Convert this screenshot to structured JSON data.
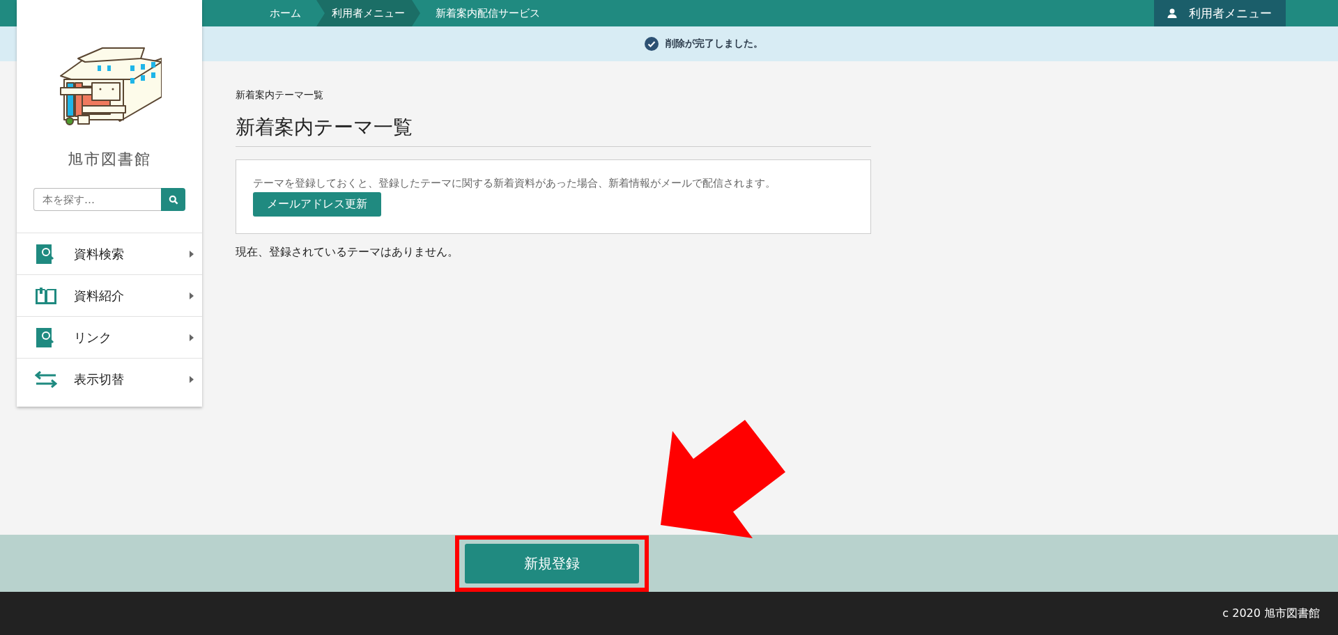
{
  "breadcrumb": [
    {
      "label": "ホーム",
      "selected": false
    },
    {
      "label": "利用者メニュー",
      "selected": true
    },
    {
      "label": "新着案内配信サービス",
      "selected": false
    }
  ],
  "user_menu": {
    "label": "利用者メニュー"
  },
  "notice": {
    "text": "削除が完了しました。"
  },
  "sidebar": {
    "library_name": "旭市図書館",
    "search": {
      "placeholder": "本を探す…"
    },
    "items": [
      {
        "label": "資料検索",
        "kind": "search"
      },
      {
        "label": "資料紹介",
        "kind": "book"
      },
      {
        "label": "リンク",
        "kind": "search"
      },
      {
        "label": "表示切替",
        "kind": "switch"
      }
    ]
  },
  "page": {
    "breadcrumb_title": "新着案内テーマ一覧",
    "title": "新着案内テーマ一覧",
    "info_text": "テーマを登録しておくと、登録したテーマに関する新着資料があった場合、新着情報がメールで配信されます。",
    "email_button": "メールアドレス更新",
    "empty_text": "現在、登録されているテーマはありません。"
  },
  "action_bar": {
    "new_button": "新規登録"
  },
  "footer": {
    "copyright": "c 2020 旭市図書館"
  }
}
